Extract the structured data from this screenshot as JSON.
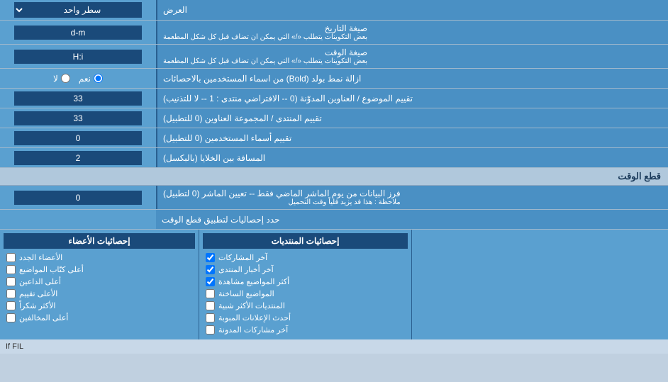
{
  "rows": [
    {
      "id": "display-mode",
      "label": "العرض",
      "controlType": "dropdown",
      "value": "سطر واحد"
    },
    {
      "id": "date-format",
      "label": "صيغة التاريخ",
      "sublabel": "بعض التكوينات يتطلب «/» التي يمكن ان تضاف قبل كل شكل المطعمة",
      "controlType": "text",
      "value": "d-m"
    },
    {
      "id": "time-format",
      "label": "صيغة الوقت",
      "sublabel": "بعض التكوينات يتطلب «/» التي يمكن ان تضاف قبل كل شكل المطعمة",
      "controlType": "text",
      "value": "H:i"
    },
    {
      "id": "bold-remove",
      "label": "ازالة نمط بولد (Bold) من اسماء المستخدمين بالاحصائات",
      "controlType": "radio",
      "options": [
        "نعم",
        "لا"
      ],
      "selected": "نعم"
    },
    {
      "id": "topic-order",
      "label": "تقييم الموضوع / العناوين المدوّنة (0 -- الافتراضي منتدى : 1 -- لا للتذنيب)",
      "controlType": "text",
      "value": "33"
    },
    {
      "id": "forum-order",
      "label": "تقييم المنتدى / المجموعة العناوين (0 للتطبيل)",
      "controlType": "text",
      "value": "33"
    },
    {
      "id": "users-order",
      "label": "تقييم أسماء المستخدمين (0 للتطبيل)",
      "controlType": "text",
      "value": "0"
    },
    {
      "id": "cell-distance",
      "label": "المسافة بين الخلايا (بالبكسل)",
      "controlType": "text",
      "value": "2"
    }
  ],
  "section_cutoff": {
    "title": "قطع الوقت",
    "row": {
      "label": "فرز البيانات من يوم الماشر الماضي فقط -- تعيين الماشر (0 لتطبيل)",
      "sublabel": "ملاحظة : هذا قد يزيد قلياً وقت التحميل",
      "value": "0"
    },
    "limit_label": "حدد إحصاليات لتطبيق قطع الوقت"
  },
  "stats_columns": [
    {
      "id": "col-right",
      "header": "",
      "items": []
    },
    {
      "id": "col-post-stats",
      "header": "إحصائيات المنتديات",
      "items": [
        "آخر المشاركات",
        "آخر أخبار المنتدى",
        "أكثر المواضيع مشاهدة",
        "المواضيع الساخنة",
        "المنتديات الأكثر شبية",
        "أحدث الإعلانات المبوبة",
        "آخر مشاركات المدونة"
      ]
    },
    {
      "id": "col-member-stats",
      "header": "إحصائيات الأعضاء",
      "items": [
        "الأعضاء الجدد",
        "أعلى كتّاب المواضيع",
        "أعلى الداعين",
        "الأعلى تقييم",
        "الأكثر شكراً",
        "أعلى المخالفين"
      ]
    }
  ],
  "checkboxes": {
    "post_stats": [
      {
        "label": "آخر المشاركات",
        "checked": true
      },
      {
        "label": "آخر أخبار المنتدى",
        "checked": true
      },
      {
        "label": "أكثر المواضيع مشاهدة",
        "checked": true
      },
      {
        "label": "المواضيع الساخنة",
        "checked": false
      },
      {
        "label": "المنتديات الأكثر شبية",
        "checked": false
      },
      {
        "label": "أحدث الإعلانات المبوبة",
        "checked": false
      },
      {
        "label": "آخر مشاركات المدونة",
        "checked": false
      }
    ],
    "member_stats": [
      {
        "label": "الأعضاء الجدد",
        "checked": false
      },
      {
        "label": "أعلى كتّاب المواضيع",
        "checked": false
      },
      {
        "label": "أعلى الداعين",
        "checked": false
      },
      {
        "label": "الأعلى تقييم",
        "checked": false
      },
      {
        "label": "الأكثر شكراً",
        "checked": false
      },
      {
        "label": "أعلى المخالفين",
        "checked": false
      }
    ]
  },
  "col_headers": {
    "post": "إحصائيات المنتديات",
    "member": "إحصائيات الأعضاء"
  },
  "footer_text": "If FIL"
}
